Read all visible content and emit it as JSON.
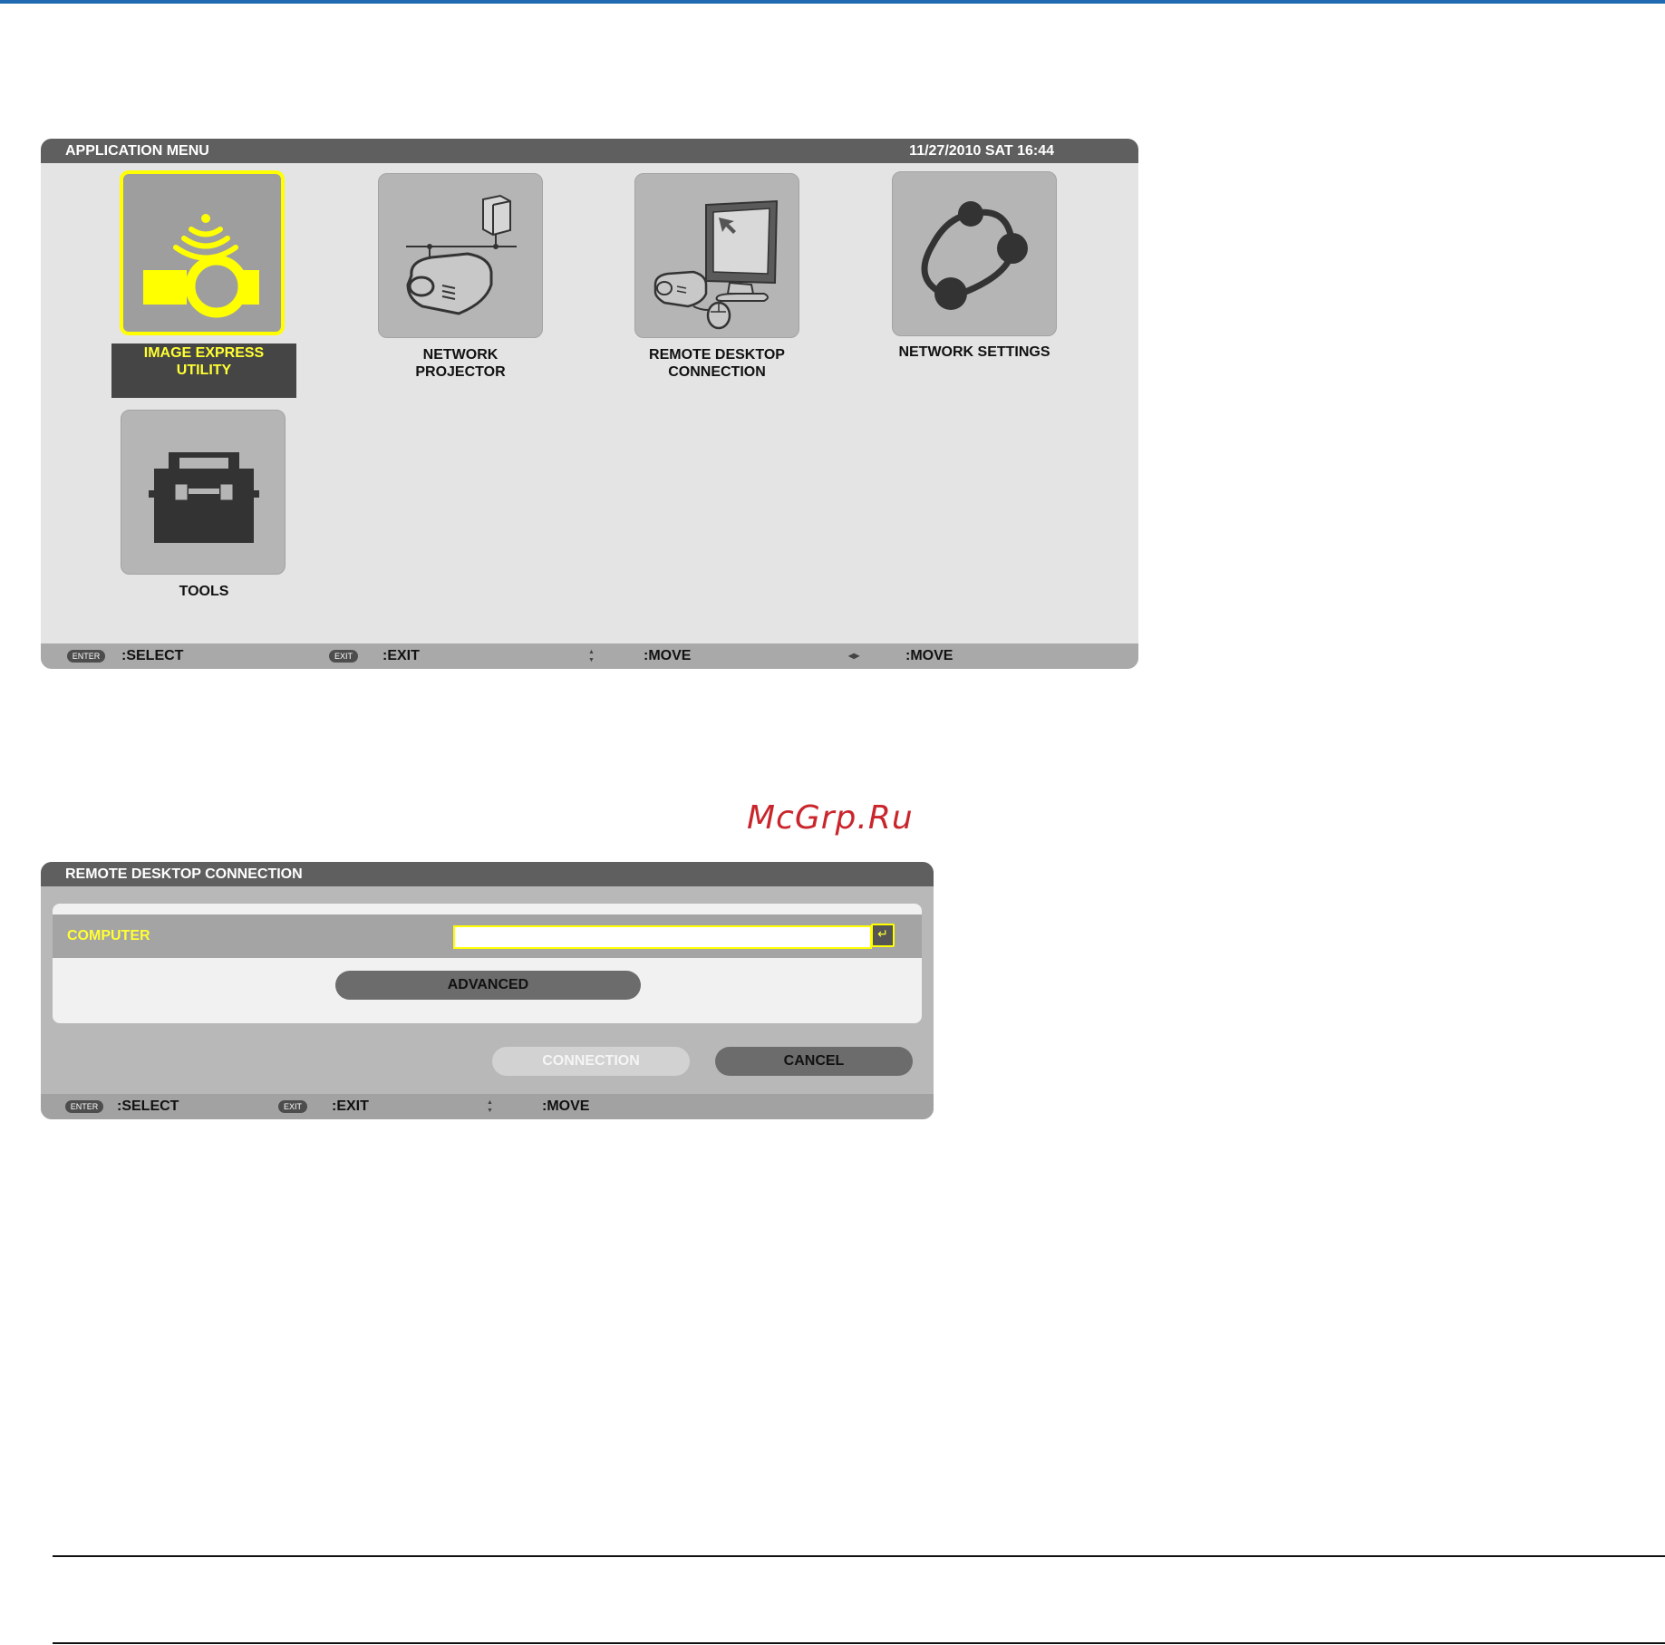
{
  "app_menu": {
    "title": "APPLICATION MENU",
    "datetime": "11/27/2010 SAT 16:44",
    "tiles": [
      {
        "label_line1": "IMAGE EXPRESS",
        "label_line2": "UTILITY",
        "icon": "image-express-icon",
        "selected": true
      },
      {
        "label_line1": "NETWORK",
        "label_line2": "PROJECTOR",
        "icon": "network-projector-icon"
      },
      {
        "label_line1": "REMOTE DESKTOP",
        "label_line2": "CONNECTION",
        "icon": "remote-desktop-icon"
      },
      {
        "label_line1": "NETWORK SETTINGS",
        "label_line2": "",
        "icon": "network-settings-icon"
      },
      {
        "label_line1": "TOOLS",
        "label_line2": "",
        "icon": "toolbox-icon"
      }
    ],
    "footer": {
      "enter_key": "ENTER",
      "select": ":SELECT",
      "exit_key": "EXIT",
      "exit": ":EXIT",
      "updown_glyph": "▲▼",
      "move_v": ":MOVE",
      "leftright_glyph": "◀▶",
      "move_h": ":MOVE"
    }
  },
  "remote_desktop": {
    "title": "REMOTE DESKTOP CONNECTION",
    "computer_label": "COMPUTER",
    "computer_value": "",
    "enter_glyph": "↵",
    "advanced": "ADVANCED",
    "connection": "CONNECTION",
    "cancel": "CANCEL",
    "footer": {
      "enter_key": "ENTER",
      "select": ":SELECT",
      "exit_key": "EXIT",
      "exit": ":EXIT",
      "updown_glyph": "▲▼",
      "move_v": ":MOVE"
    }
  },
  "watermark": "McGrp.Ru",
  "colors": {
    "accent": "#ffff00",
    "title_bar": "#5f5f5f",
    "footer_bar": "#a9a9a9",
    "top_rule": "#1f6ab1",
    "watermark": "#c9262c"
  }
}
